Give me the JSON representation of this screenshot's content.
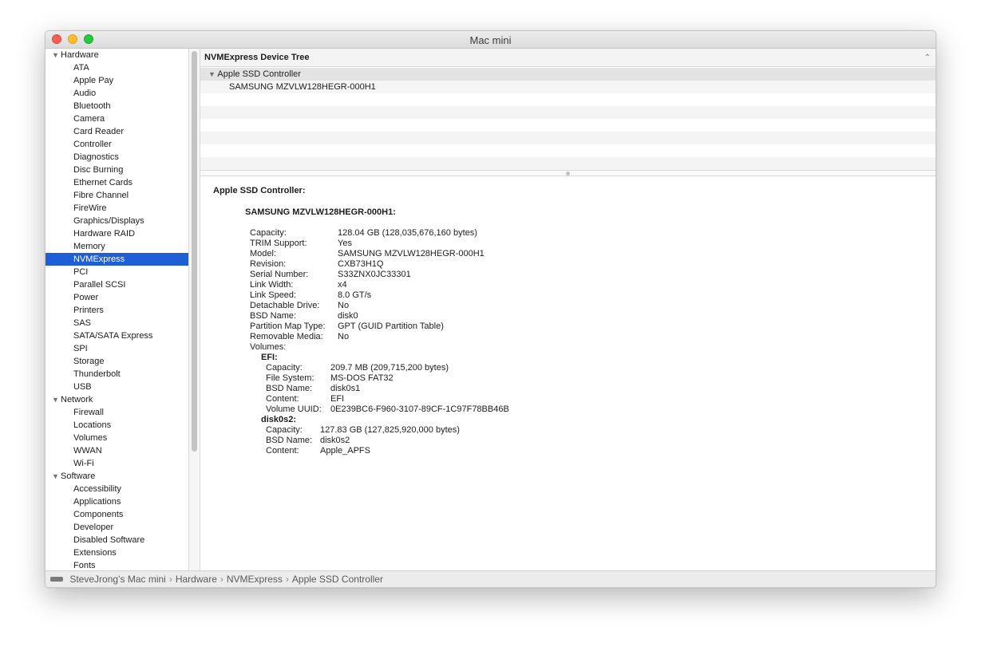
{
  "window": {
    "title": "Mac mini"
  },
  "sidebar": {
    "hardware_label": "Hardware",
    "hardware_items": [
      "ATA",
      "Apple Pay",
      "Audio",
      "Bluetooth",
      "Camera",
      "Card Reader",
      "Controller",
      "Diagnostics",
      "Disc Burning",
      "Ethernet Cards",
      "Fibre Channel",
      "FireWire",
      "Graphics/Displays",
      "Hardware RAID",
      "Memory",
      "NVMExpress",
      "PCI",
      "Parallel SCSI",
      "Power",
      "Printers",
      "SAS",
      "SATA/SATA Express",
      "SPI",
      "Storage",
      "Thunderbolt",
      "USB"
    ],
    "selected_item": "NVMExpress",
    "network_label": "Network",
    "network_items": [
      "Firewall",
      "Locations",
      "Volumes",
      "WWAN",
      "Wi-Fi"
    ],
    "software_label": "Software",
    "software_items": [
      "Accessibility",
      "Applications",
      "Components",
      "Developer",
      "Disabled Software",
      "Extensions",
      "Fonts"
    ]
  },
  "tree": {
    "header": "NVMExpress Device Tree",
    "controller": "Apple SSD Controller",
    "device": "SAMSUNG MZVLW128HEGR-000H1"
  },
  "detail": {
    "title": "Apple SSD Controller:",
    "device_title": "SAMSUNG MZVLW128HEGR-000H1:",
    "properties": [
      {
        "key": "Capacity:",
        "value": "128.04 GB (128,035,676,160 bytes)"
      },
      {
        "key": "TRIM Support:",
        "value": "Yes"
      },
      {
        "key": "Model:",
        "value": "SAMSUNG MZVLW128HEGR-000H1"
      },
      {
        "key": "Revision:",
        "value": "CXB73H1Q"
      },
      {
        "key": "Serial Number:",
        "value": "S33ZNX0JC33301"
      },
      {
        "key": "Link Width:",
        "value": "x4"
      },
      {
        "key": "Link Speed:",
        "value": "8.0 GT/s"
      },
      {
        "key": "Detachable Drive:",
        "value": "No"
      },
      {
        "key": "BSD Name:",
        "value": "disk0"
      },
      {
        "key": "Partition Map Type:",
        "value": "GPT (GUID Partition Table)"
      },
      {
        "key": "Removable Media:",
        "value": "No"
      }
    ],
    "volumes_label": "Volumes:",
    "volumes": [
      {
        "name": "EFI:",
        "properties": [
          {
            "key": "Capacity:",
            "value": "209.7 MB (209,715,200 bytes)"
          },
          {
            "key": "File System:",
            "value": "MS-DOS FAT32"
          },
          {
            "key": "BSD Name:",
            "value": "disk0s1"
          },
          {
            "key": "Content:",
            "value": "EFI"
          },
          {
            "key": "Volume UUID:",
            "value": "0E239BC6-F960-3107-89CF-1C97F78BB46B"
          }
        ]
      },
      {
        "name": "disk0s2:",
        "properties": [
          {
            "key": "Capacity:",
            "value": "127.83 GB (127,825,920,000 bytes)"
          },
          {
            "key": "BSD Name:",
            "value": "disk0s2"
          },
          {
            "key": "Content:",
            "value": "Apple_APFS"
          }
        ]
      }
    ]
  },
  "statusbar": {
    "path": [
      "SteveJrong’s Mac mini",
      "Hardware",
      "NVMExpress",
      "Apple SSD Controller"
    ],
    "separator": "›"
  }
}
